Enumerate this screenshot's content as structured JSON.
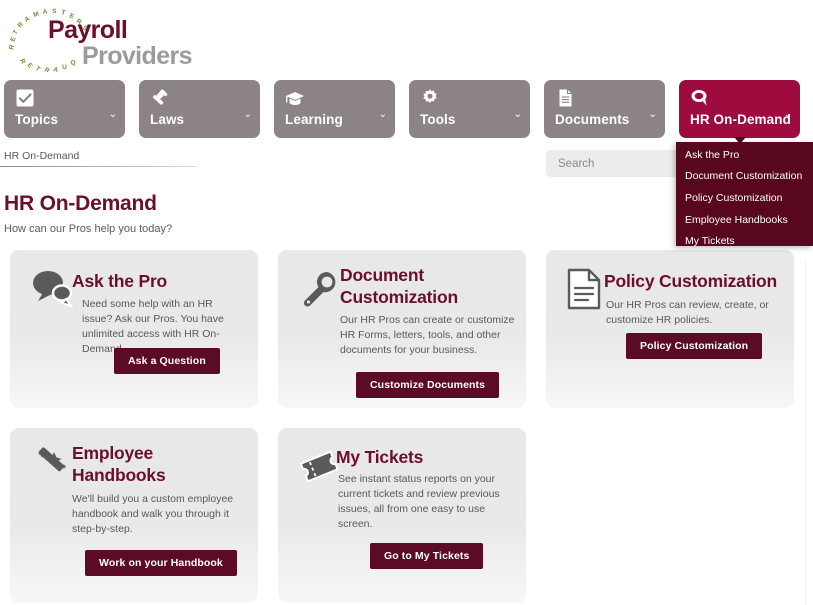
{
  "brand": {
    "name_line1": "Payroll",
    "name_line2": "Providers",
    "arc_text": "QUARTERMASTERS AND",
    "color_primary": "#6b0f2b",
    "color_secondary": "#9b9b9b",
    "color_arc": "#6f8f3a"
  },
  "nav": {
    "items": [
      {
        "label": "Topics",
        "icon": "checkbox-icon",
        "caret": "⌄",
        "active": false
      },
      {
        "label": "Laws",
        "icon": "gavel-icon",
        "caret": "⌄",
        "active": false
      },
      {
        "label": "Learning",
        "icon": "graduation-cap-icon",
        "caret": "⌄",
        "active": false
      },
      {
        "label": "Tools",
        "icon": "gear-icon",
        "caret": "⌄",
        "active": false
      },
      {
        "label": "Documents",
        "icon": "document-icon",
        "caret": "⌄",
        "active": false
      },
      {
        "label": "HR On-Demand",
        "icon": "chat-bubble-icon",
        "caret": "⌄",
        "active": true
      }
    ],
    "inactive_color": "#8c8484",
    "active_color": "#9d0b3f"
  },
  "dropdown": {
    "background": "#58071f",
    "items": [
      {
        "label": "Ask the Pro"
      },
      {
        "label": "Document Customization"
      },
      {
        "label": "Policy Customization"
      },
      {
        "label": "Employee Handbooks"
      },
      {
        "label": "My Tickets"
      }
    ]
  },
  "breadcrumb": {
    "text": "HR On-Demand"
  },
  "search": {
    "placeholder": "Search",
    "value": ""
  },
  "page": {
    "title": "HR On-Demand",
    "subtitle": "How can our Pros help you today?"
  },
  "cards": [
    {
      "title": "Ask the Pro",
      "title_lines": [
        "Ask the Pro"
      ],
      "icon": "chat-bubbles-icon",
      "description": "Need some help with an HR issue? Ask our Pros. You have unlimited access with HR On-Demand.",
      "button_label": "Ask a Question"
    },
    {
      "title": "Document Customization",
      "title_lines": [
        "Document",
        "Customization"
      ],
      "icon": "wrench-icon",
      "description": "Our HR Pros can create or customize HR Forms, letters, tools, and other documents for your business.",
      "button_label": "Customize Documents"
    },
    {
      "title": "Policy Customization",
      "title_lines": [
        "Policy Customization"
      ],
      "icon": "document-lines-icon",
      "description": "Our HR Pros can review, create, or customize HR policies.",
      "button_label": "Policy Customization"
    },
    {
      "title": "Employee Handbooks",
      "title_lines": [
        "Employee",
        "Handbooks"
      ],
      "icon": "magic-wand-icon",
      "description": "We'll build you a custom employee handbook and walk you through it step-by-step.",
      "button_label": "Work on your Handbook"
    },
    {
      "title": "My Tickets",
      "title_lines": [
        "My Tickets"
      ],
      "icon": "ticket-icon",
      "description": "See instant status reports on your current tickets and review previous issues, all from one easy to use screen.",
      "button_label": "Go to My Tickets"
    }
  ]
}
